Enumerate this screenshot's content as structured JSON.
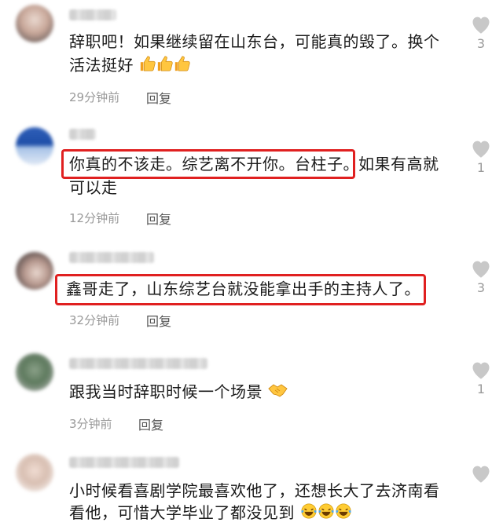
{
  "comments": [
    {
      "lines": [
        "辞职吧！如果继续留在山东台，可能真的毁了。换个",
        "活法挺好"
      ],
      "emoji": [
        "thumbs-up-icon",
        "thumbs-up-icon",
        "thumbs-up-icon"
      ],
      "time": "29分钟前",
      "reply": "回复",
      "likes": "3"
    },
    {
      "highlight": "你真的不该走。综艺离不开你。台柱子。",
      "lines": [
        "如果有高就",
        "可以走"
      ],
      "time": "12分钟前",
      "reply": "回复",
      "likes": "1"
    },
    {
      "highlight": "鑫哥走了，山东综艺台就没能拿出手的主持人了。",
      "time": "32分钟前",
      "reply": "回复",
      "likes": "3"
    },
    {
      "lines": [
        "跟我当时辞职时候一个场景"
      ],
      "emoji": [
        "handshake-icon"
      ],
      "time": "3分钟前",
      "reply": "回复",
      "likes": "1"
    },
    {
      "lines": [
        "小时候看喜剧学院最喜欢他了，还想长大了去济南看",
        "看他，可惜大学毕业了都没见到"
      ],
      "emoji": [
        "laughing-tears-icon",
        "laughing-tears-icon",
        "laughing-tears-icon"
      ]
    }
  ],
  "colors": {
    "highlight_border": "#e02020",
    "meta": "#999999",
    "heart": "#c8c8c8"
  }
}
